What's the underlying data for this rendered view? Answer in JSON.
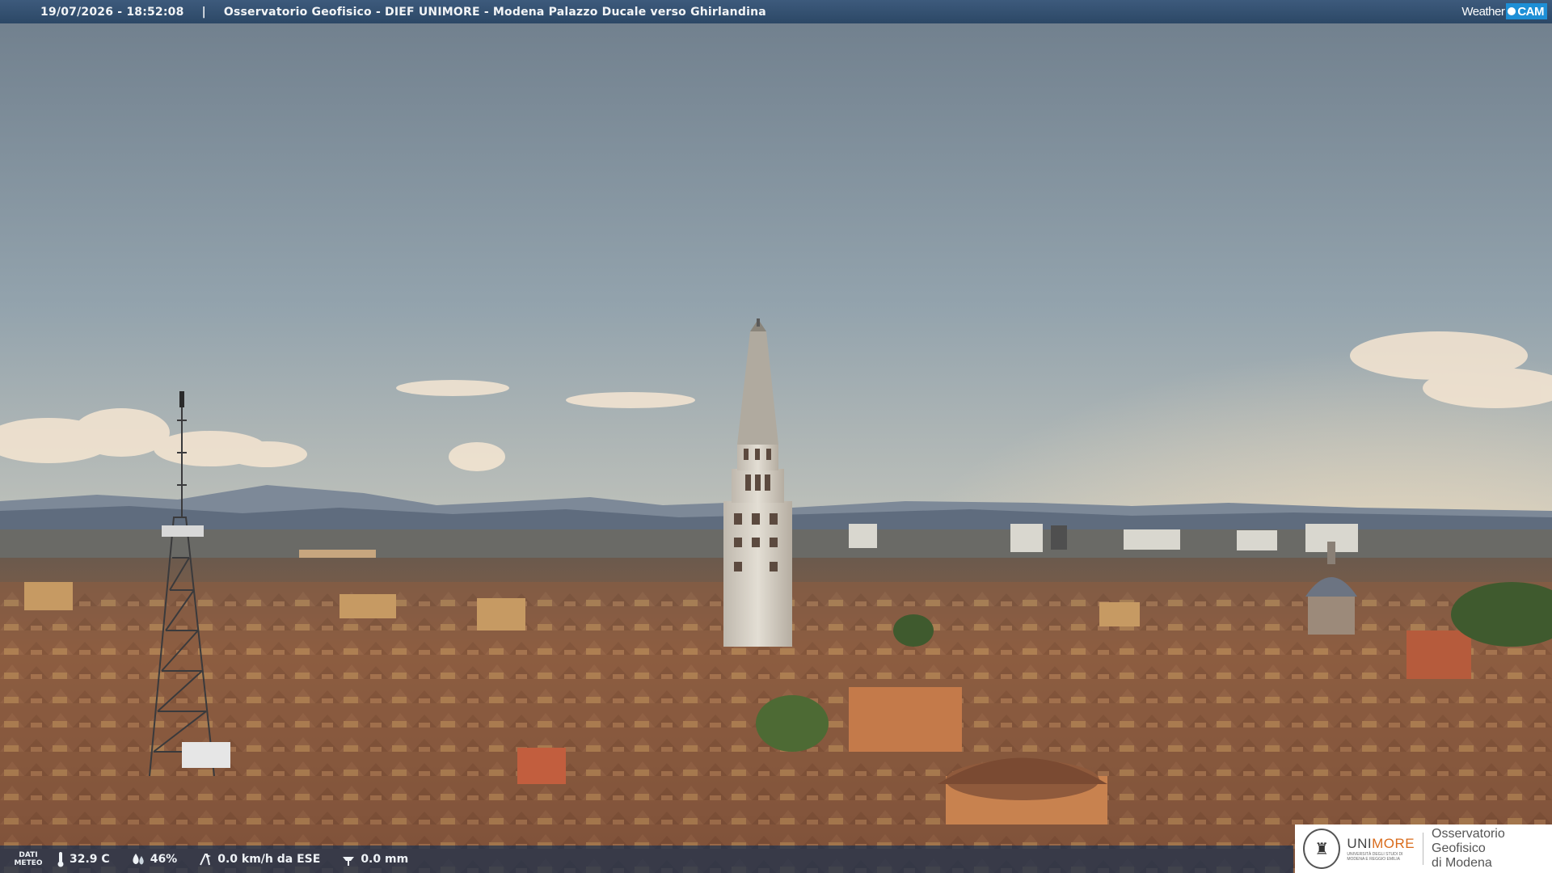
{
  "header": {
    "timestamp": "19/07/2026 - 18:52:08",
    "separator": "|",
    "title": "Osservatorio Geofisico - DIEF UNIMORE - Modena Palazzo Ducale verso Ghirlandina",
    "brand_weather": "Weather",
    "brand_cam": "CAM"
  },
  "meteo": {
    "label_line1": "DATI",
    "label_line2": "METEO",
    "temperature": "32.9 C",
    "humidity": "46%",
    "wind": "0.0 km/h da ESE",
    "rain": "0.0 mm"
  },
  "logo": {
    "uni_prefix": "UNI",
    "uni_suffix": "MORE",
    "uni_sub_line1": "UNIVERSITÀ DEGLI STUDI DI",
    "uni_sub_line2": "MODENA E REGGIO EMILIA",
    "obs_line1": "Osservatorio Geofisico",
    "obs_line2": "di Modena"
  },
  "colors": {
    "sky_top": "#7e8c99",
    "sky_horizon": "#f2d1b0",
    "roof": "#8a5a3c",
    "bar": "#2c4866",
    "accent_cam": "#1e8fd6",
    "unimore_orange": "#d96b1b"
  }
}
